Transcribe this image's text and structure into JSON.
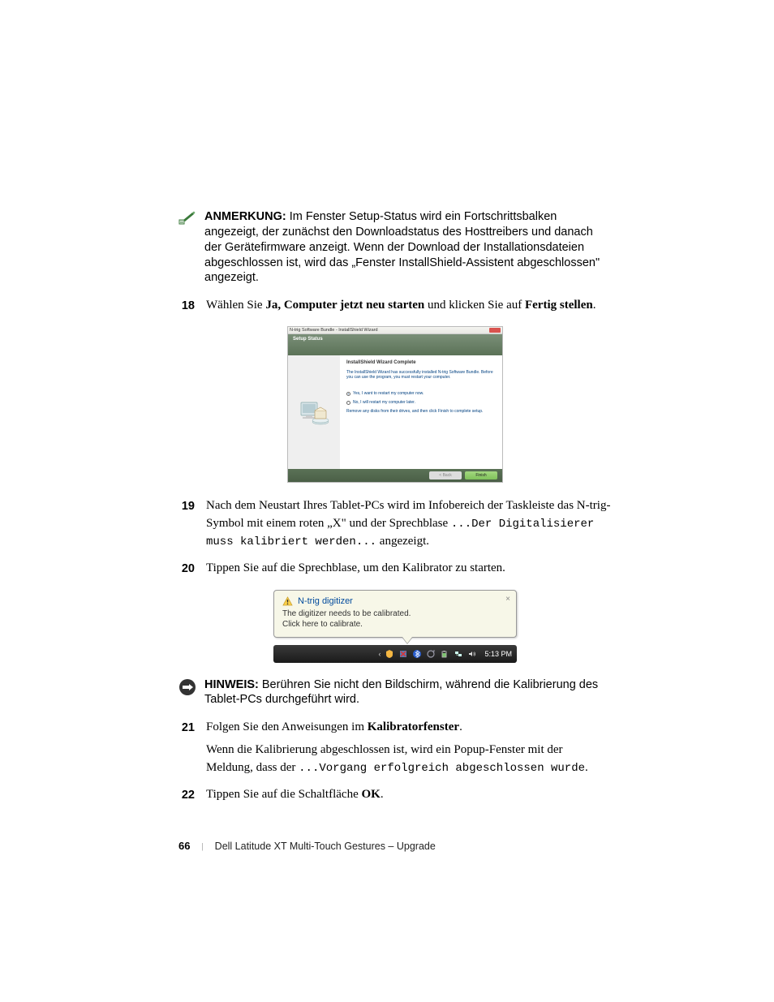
{
  "notes": {
    "anmerkung": {
      "label": "ANMERKUNG:",
      "text_prefix": " Im Fenster ",
      "bold1": "Setup-Status",
      "text_rest": " wird ein Fortschrittsbalken angezeigt, der zunächst den Downloadstatus des Hosttreibers und danach der Gerätefirmware anzeigt. Wenn der Download der Installationsdateien abgeschlossen ist, wird das „Fenster InstallShield-Assistent abgeschlossen\" angezeigt."
    },
    "hinweis": {
      "label": "HINWEIS:",
      "text": " Berühren Sie nicht den Bildschirm, während die Kalibrierung des Tablet-PCs durchgeführt wird."
    }
  },
  "steps": {
    "s18": {
      "num": "18",
      "t1": "Wählen Sie ",
      "b1": "Ja, Computer jetzt neu starten",
      "t2": " und klicken Sie auf ",
      "b2": "Fertig stellen",
      "t3": "."
    },
    "s19": {
      "num": "19",
      "t1": "Nach dem Neustart Ihres Tablet-PCs wird im Infobereich der Taskleiste das N-trig-Symbol mit einem roten „X\" und der Sprechblase ",
      "mono1": "...Der Digitalisierer muss kalibriert werden...",
      "t2": " angezeigt."
    },
    "s20": {
      "num": "20",
      "t1": "Tippen Sie auf die Sprechblase, um den Kalibrator zu starten."
    },
    "s21": {
      "num": "21",
      "t1": "Folgen Sie den Anweisungen im ",
      "b1": "Kalibratorfenster",
      "t2": ".",
      "cont_t1": "Wenn die Kalibrierung abgeschlossen ist, wird ein Popup-Fenster mit der Meldung, dass der ",
      "cont_mono": "...Vorgang erfolgreich abgeschlossen wurde",
      "cont_t2": "."
    },
    "s22": {
      "num": "22",
      "t1": "Tippen Sie auf die Schaltfläche ",
      "b1": "OK",
      "t2": "."
    }
  },
  "install_dialog": {
    "title": "N-trig Software Bundle - InstallShield Wizard",
    "banner": "Setup Status",
    "heading": "InstallShield Wizard Complete",
    "desc": "The InstallShield Wizard has successfully installed N-trig Software Bundle. Before you can use the program, you must restart your computer.",
    "radio1": "Yes, I want to restart my computer now.",
    "radio2": "No, I will restart my computer later.",
    "hint": "Remove any disks from their drives, and then click Finish to complete setup.",
    "back": "< Back",
    "finish": "Finish"
  },
  "balloon": {
    "title": "N-trig digitizer",
    "line1": "The digitizer needs to be calibrated.",
    "line2": "Click here to calibrate.",
    "close": "×"
  },
  "taskbar": {
    "time": "5:13 PM",
    "chevron": "‹"
  },
  "footer": {
    "page_num": "66",
    "divider": "|",
    "title": "Dell Latitude XT Multi-Touch Gestures – Upgrade"
  }
}
